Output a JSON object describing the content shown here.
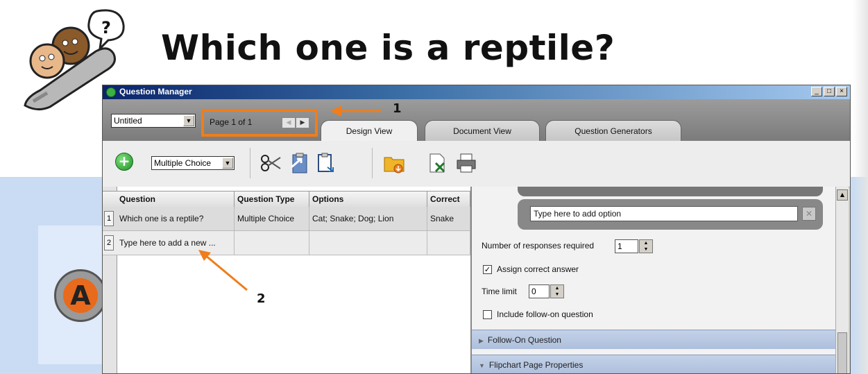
{
  "slide": {
    "title": "Which one is a reptile?",
    "answer_letter": "A"
  },
  "window": {
    "title": "Question Manager",
    "controls": [
      "_",
      "□",
      "×"
    ]
  },
  "tabbar": {
    "document_select": "Untitled",
    "pager_label": "Page 1 of 1",
    "tabs": [
      {
        "label": "Design View",
        "active": true
      },
      {
        "label": "Document View",
        "active": false
      },
      {
        "label": "Question Generators",
        "active": false
      }
    ]
  },
  "toolbar": {
    "question_type_select": "Multiple Choice",
    "icons": [
      "add-question-icon",
      "cut-icon",
      "export-icon",
      "paste-icon",
      "open-folder-icon",
      "export-excel-icon",
      "print-icon"
    ]
  },
  "grid": {
    "columns": [
      "Question",
      "Question Type",
      "Options",
      "Correct"
    ],
    "rows": [
      {
        "num": "1",
        "question": "Which one is a reptile?",
        "type": "Multiple Choice",
        "options": "Cat; Snake; Dog; Lion",
        "correct": "Snake"
      },
      {
        "num": "2",
        "question": "Type here to add a new ...",
        "type": "",
        "options": "",
        "correct": ""
      }
    ]
  },
  "properties": {
    "option_placeholder": "Type here to add option",
    "responses_label": "Number of responses required",
    "responses_value": "1",
    "assign_correct_label": "Assign correct answer",
    "assign_correct_checked": true,
    "time_limit_label": "Time limit",
    "time_limit_value": "0",
    "follow_on_label": "Include follow-on question",
    "follow_on_checked": false,
    "sections": [
      "Follow-On Question",
      "Flipchart Page Properties"
    ]
  },
  "callouts": {
    "one": "1",
    "two": "2"
  },
  "colors": {
    "accent_orange": "#f07d1a",
    "title_bar": "#0a246a"
  }
}
